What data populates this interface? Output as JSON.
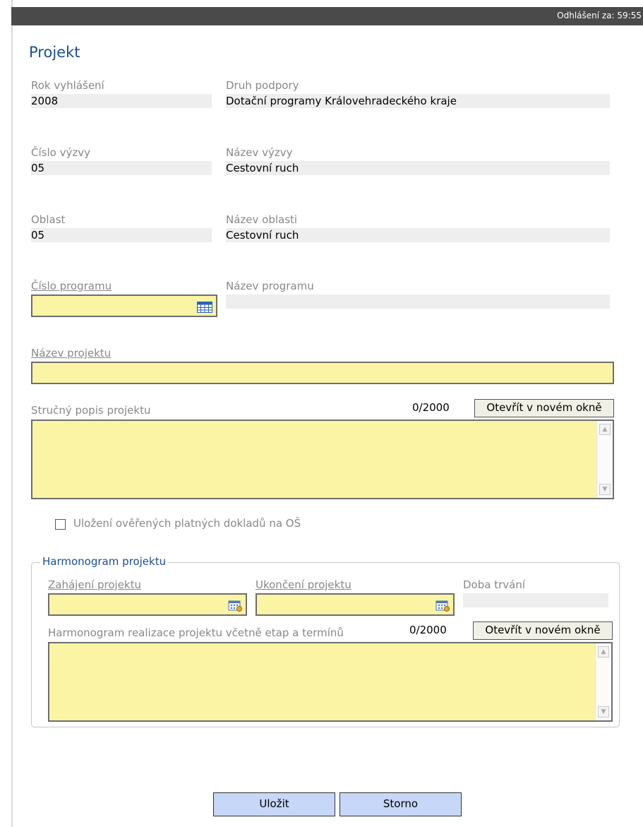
{
  "header": {
    "session_text": "Odhlášení za: 59:55"
  },
  "page": {
    "title": "Projekt"
  },
  "fields": {
    "rok_vyhlaseni": {
      "label": "Rok vyhlášení",
      "value": "2008"
    },
    "druh_podpory": {
      "label": "Druh podpory",
      "value": "Dotační programy Královehradeckého kraje"
    },
    "cislo_vyzvy": {
      "label": "Číslo výzvy",
      "value": "05"
    },
    "nazev_vyzvy": {
      "label": "Název výzvy",
      "value": "Cestovní ruch"
    },
    "oblast": {
      "label": "Oblast",
      "value": "05"
    },
    "nazev_oblasti": {
      "label": "Název oblasti",
      "value": "Cestovní ruch"
    },
    "cislo_programu": {
      "label": "Číslo programu",
      "value": ""
    },
    "nazev_programu": {
      "label": "Název programu",
      "value": ""
    },
    "nazev_projektu": {
      "label": "Název projektu",
      "value": ""
    },
    "strucny_popis": {
      "label": "Stručný popis projektu",
      "counter": "0/2000",
      "open_button": "Otevřít v novém okně",
      "value": ""
    },
    "ulozeni_dokladu": {
      "label": "Uložení ověřených platných dokladů na OŠ",
      "checked": false
    }
  },
  "harmonogram": {
    "legend": "Harmonogram projektu",
    "zahajeni": {
      "label": "Zahájení projektu",
      "value": ""
    },
    "ukonceni": {
      "label": "Ukončení projektu",
      "value": ""
    },
    "doba_trvani": {
      "label": "Doba trvání",
      "value": ""
    },
    "realizace": {
      "label": "Harmonogram realizace projektu včetně etap a termínů",
      "counter": "0/2000",
      "open_button": "Otevřít v novém okně",
      "value": ""
    }
  },
  "buttons": {
    "save": "Uložit",
    "cancel": "Storno"
  },
  "icons": {
    "lookup": "table-lookup-icon",
    "date": "calendar-icon"
  },
  "colors": {
    "title": "#1b4f8f",
    "input_bg": "#fbf4a4",
    "readonly_bg": "#eeeeee",
    "primary_button": "#c7d7f7"
  }
}
